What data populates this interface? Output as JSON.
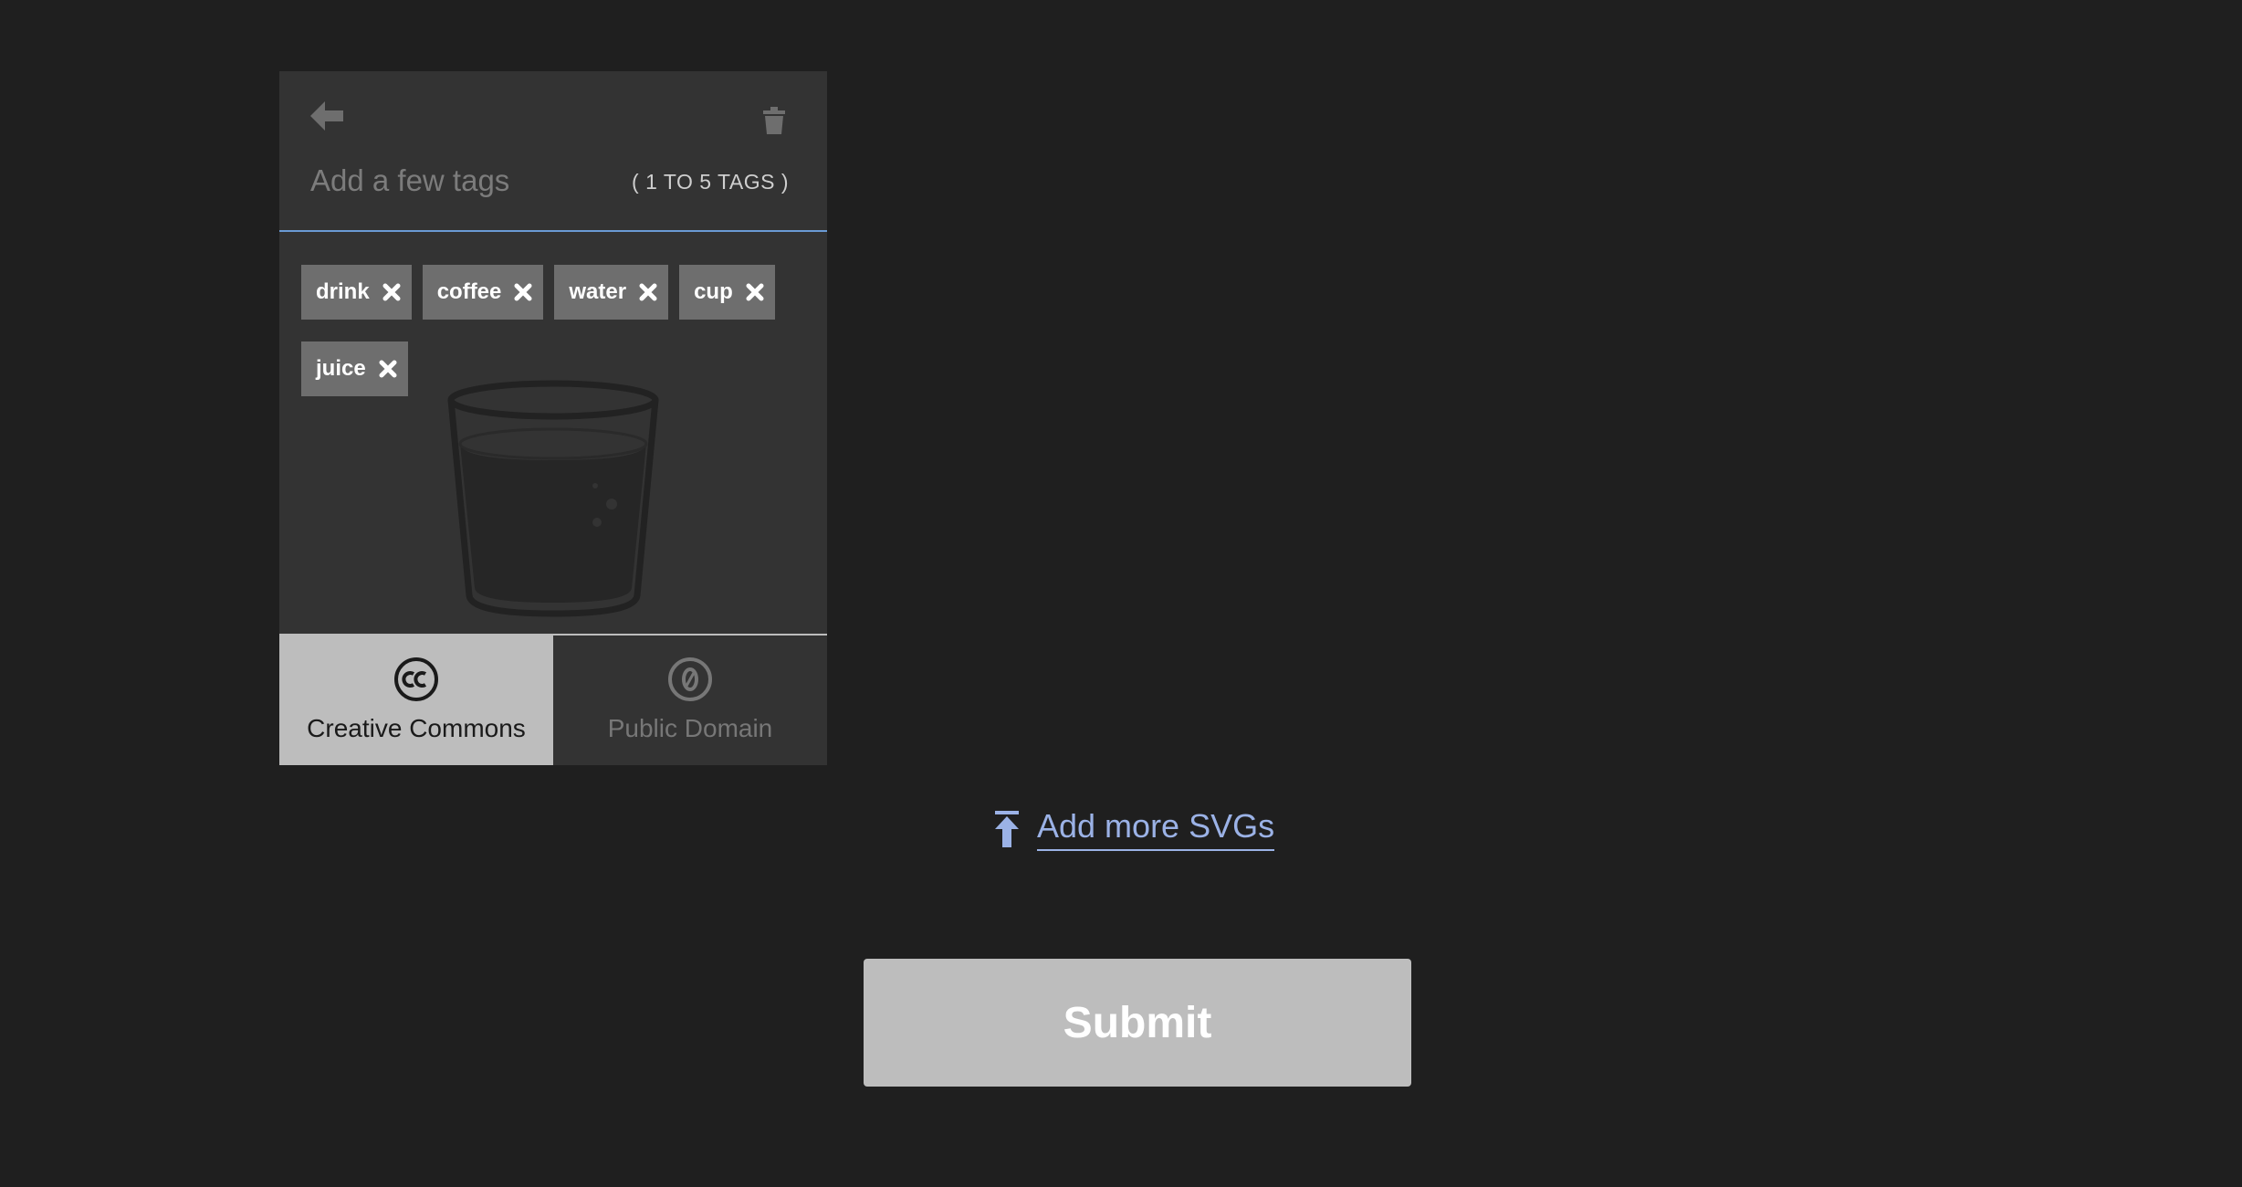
{
  "editor": {
    "back_icon": "arrow-left-icon",
    "trash_icon": "trash-icon",
    "tag_placeholder": "Add a few tags",
    "tag_hint": "( 1 TO 5 TAGS )",
    "preview_icon": "drinking-glass-icon",
    "tags": [
      {
        "label": "drink"
      },
      {
        "label": "coffee"
      },
      {
        "label": "water"
      },
      {
        "label": "cup"
      },
      {
        "label": "juice"
      }
    ],
    "licenses": [
      {
        "label": "Creative Commons",
        "icon": "creative-commons-icon",
        "selected": true
      },
      {
        "label": "Public Domain",
        "icon": "public-domain-icon",
        "selected": false
      }
    ]
  },
  "actions": {
    "add_more_label": "Add more SVGs",
    "add_more_icon": "upload-arrow-icon",
    "submit_label": "Submit"
  },
  "colors": {
    "background": "#1f1f1f",
    "card": "#333333",
    "chip": "#6e6e6e",
    "accent_link": "#9bb2e6",
    "input_underline": "#6a9ad4",
    "button": "#bdbdbd"
  }
}
